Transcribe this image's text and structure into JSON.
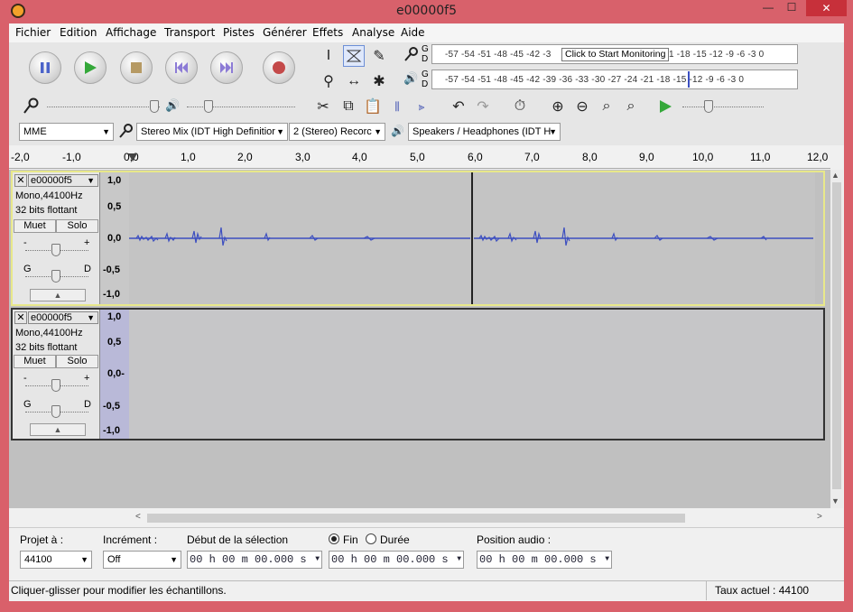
{
  "window": {
    "title": "e00000f5",
    "minimize": "—",
    "maximize": "☐",
    "close": "✕"
  },
  "menu": [
    "Fichier",
    "Edition",
    "Affichage",
    "Transport",
    "Pistes",
    "Générer",
    "Effets",
    "Analyse",
    "Aide"
  ],
  "meters": {
    "record_lr": "G\nD",
    "record_scale": "-57 -54 -51 -48 -45 -42 -3",
    "monitor_hint": "Click to Start Monitoring",
    "record_scale_tail": "1 -18 -15 -12  -9  -6  -3  0",
    "play_scale": "-57 -54 -51 -48 -45 -42 -39 -36 -33 -30 -27 -24 -21 -18 -15 -12  -9  -6  -3  0"
  },
  "devices": {
    "host": "MME",
    "input": "Stereo Mix (IDT High Definitior",
    "channels": "2 (Stereo) Recorc",
    "output": "Speakers / Headphones (IDT H"
  },
  "ruler": [
    "-2,0",
    "-1,0",
    "0,0",
    "1,0",
    "2,0",
    "3,0",
    "4,0",
    "5,0",
    "6,0",
    "7,0",
    "8,0",
    "9,0",
    "10,0",
    "11,0",
    "12,0"
  ],
  "tracks": [
    {
      "name": "e00000f5",
      "info1": "Mono,44100Hz",
      "info2": "32 bits flottant",
      "mute": "Muet",
      "solo": "Solo",
      "pan_left": "G",
      "pan_right": "D",
      "gain_minus": "-",
      "gain_plus": "+",
      "scale": [
        "1,0",
        "0,5",
        "0,0",
        "-0,5",
        "-1,0"
      ]
    },
    {
      "name": "e00000f5",
      "info1": "Mono,44100Hz",
      "info2": "32 bits flottant",
      "mute": "Muet",
      "solo": "Solo",
      "pan_left": "G",
      "pan_right": "D",
      "gain_minus": "-",
      "gain_plus": "+",
      "scale": [
        "1,0",
        "0,5",
        "0,0-",
        "-0,5",
        "-1,0"
      ]
    }
  ],
  "selection": {
    "project_label": "Projet à :",
    "project_rate": "44100",
    "increment_label": "Incrément :",
    "increment_value": "Off",
    "sel_start_label": "Début de la sélection",
    "end_label": "Fin",
    "duration_label": "Durée",
    "audio_pos_label": "Position audio :",
    "time_value": "00 h 00 m 00.000 s"
  },
  "status": {
    "left": "Cliquer-glisser pour modifier les échantillons.",
    "right": "Taux actuel : 44100"
  }
}
